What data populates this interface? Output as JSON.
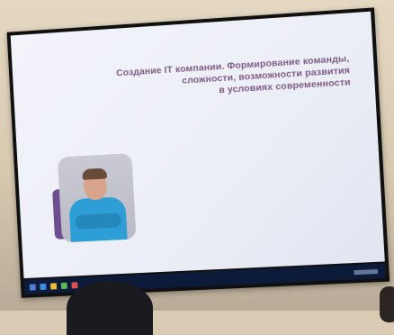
{
  "slide": {
    "title_lines": [
      "Создание IT компании. Формирование команды,",
      "сложности, возможности развития",
      "в условиях современности"
    ],
    "subtitle_lines": []
  }
}
